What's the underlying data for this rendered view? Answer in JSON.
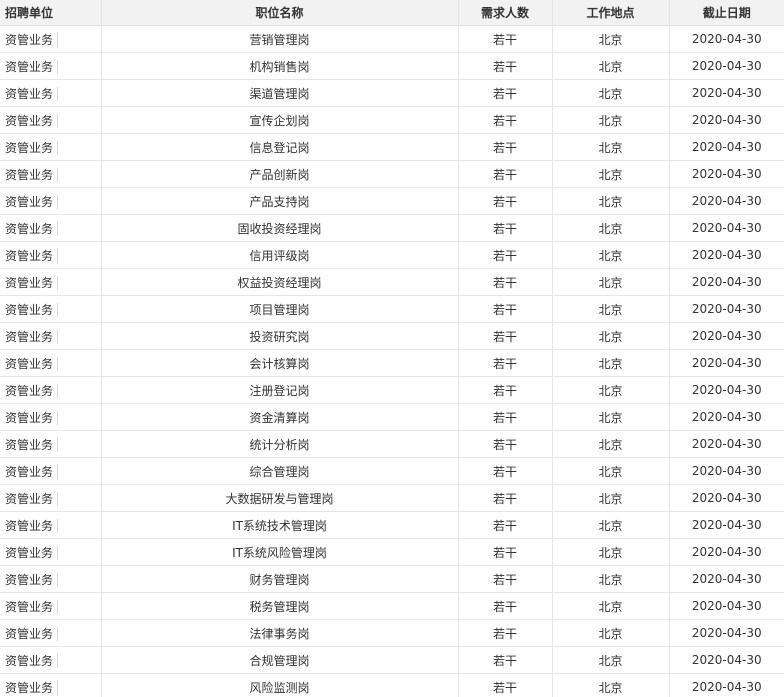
{
  "table": {
    "headers": {
      "unit": "招聘单位",
      "position": "职位名称",
      "count": "需求人数",
      "location": "工作地点",
      "deadline": "截止日期"
    },
    "rows": [
      {
        "unit": "资管业务",
        "position": "营销管理岗",
        "count": "若干",
        "location": "北京",
        "deadline": "2020-04-30"
      },
      {
        "unit": "资管业务",
        "position": "机构销售岗",
        "count": "若干",
        "location": "北京",
        "deadline": "2020-04-30"
      },
      {
        "unit": "资管业务",
        "position": "渠道管理岗",
        "count": "若干",
        "location": "北京",
        "deadline": "2020-04-30"
      },
      {
        "unit": "资管业务",
        "position": "宣传企划岗",
        "count": "若干",
        "location": "北京",
        "deadline": "2020-04-30"
      },
      {
        "unit": "资管业务",
        "position": "信息登记岗",
        "count": "若干",
        "location": "北京",
        "deadline": "2020-04-30"
      },
      {
        "unit": "资管业务",
        "position": "产品创新岗",
        "count": "若干",
        "location": "北京",
        "deadline": "2020-04-30"
      },
      {
        "unit": "资管业务",
        "position": "产品支持岗",
        "count": "若干",
        "location": "北京",
        "deadline": "2020-04-30"
      },
      {
        "unit": "资管业务",
        "position": "固收投资经理岗",
        "count": "若干",
        "location": "北京",
        "deadline": "2020-04-30"
      },
      {
        "unit": "资管业务",
        "position": "信用评级岗",
        "count": "若干",
        "location": "北京",
        "deadline": "2020-04-30"
      },
      {
        "unit": "资管业务",
        "position": "权益投资经理岗",
        "count": "若干",
        "location": "北京",
        "deadline": "2020-04-30"
      },
      {
        "unit": "资管业务",
        "position": "项目管理岗",
        "count": "若干",
        "location": "北京",
        "deadline": "2020-04-30"
      },
      {
        "unit": "资管业务",
        "position": "投资研究岗",
        "count": "若干",
        "location": "北京",
        "deadline": "2020-04-30"
      },
      {
        "unit": "资管业务",
        "position": "会计核算岗",
        "count": "若干",
        "location": "北京",
        "deadline": "2020-04-30"
      },
      {
        "unit": "资管业务",
        "position": "注册登记岗",
        "count": "若干",
        "location": "北京",
        "deadline": "2020-04-30"
      },
      {
        "unit": "资管业务",
        "position": "资金清算岗",
        "count": "若干",
        "location": "北京",
        "deadline": "2020-04-30"
      },
      {
        "unit": "资管业务",
        "position": "统计分析岗",
        "count": "若干",
        "location": "北京",
        "deadline": "2020-04-30"
      },
      {
        "unit": "资管业务",
        "position": "综合管理岗",
        "count": "若干",
        "location": "北京",
        "deadline": "2020-04-30"
      },
      {
        "unit": "资管业务",
        "position": "大数据研发与管理岗",
        "count": "若干",
        "location": "北京",
        "deadline": "2020-04-30"
      },
      {
        "unit": "资管业务",
        "position": "IT系统技术管理岗",
        "count": "若干",
        "location": "北京",
        "deadline": "2020-04-30"
      },
      {
        "unit": "资管业务",
        "position": "IT系统风险管理岗",
        "count": "若干",
        "location": "北京",
        "deadline": "2020-04-30"
      },
      {
        "unit": "资管业务",
        "position": "财务管理岗",
        "count": "若干",
        "location": "北京",
        "deadline": "2020-04-30"
      },
      {
        "unit": "资管业务",
        "position": "税务管理岗",
        "count": "若干",
        "location": "北京",
        "deadline": "2020-04-30"
      },
      {
        "unit": "资管业务",
        "position": "法律事务岗",
        "count": "若干",
        "location": "北京",
        "deadline": "2020-04-30"
      },
      {
        "unit": "资管业务",
        "position": "合规管理岗",
        "count": "若干",
        "location": "北京",
        "deadline": "2020-04-30"
      },
      {
        "unit": "资管业务",
        "position": "风险监测岗",
        "count": "若干",
        "location": "北京",
        "deadline": "2020-04-30"
      }
    ]
  }
}
